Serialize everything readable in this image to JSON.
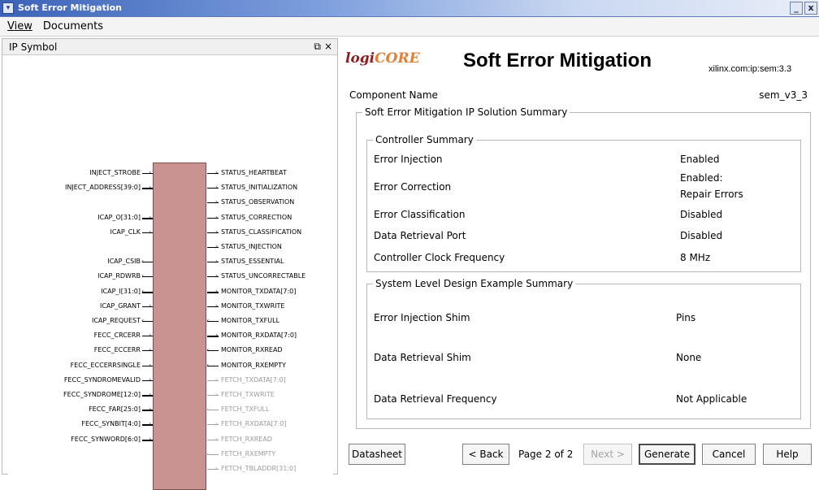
{
  "window": {
    "title": "Soft Error Mitigation",
    "sys_icon": "chevron-down-icon",
    "min_label": "_",
    "close_label": "x"
  },
  "menubar": {
    "items": [
      {
        "label": "View"
      },
      {
        "label": "Documents"
      }
    ]
  },
  "left_panel": {
    "title": "IP Symbol",
    "restore_glyph": "⧉",
    "close_glyph": "×",
    "inputs": [
      "INJECT_STROBE",
      "INJECT_ADDRESS[39:0]",
      "ICAP_O[31:0]",
      "ICAP_CLK",
      "ICAP_CSIB",
      "ICAP_RDWRB",
      "ICAP_I[31:0]",
      "ICAP_GRANT",
      "ICAP_REQUEST",
      "FECC_CRCERR",
      "FECC_ECCERR",
      "FECC_ECCERRSINGLE",
      "FECC_SYNDROMEVALID",
      "FECC_SYNDROME[12:0]",
      "FECC_FAR[25:0]",
      "FECC_SYNBIT[4:0]",
      "FECC_SYNWORD[6:0]"
    ],
    "outputs": [
      "STATUS_HEARTBEAT",
      "STATUS_INITIALIZATION",
      "STATUS_OBSERVATION",
      "STATUS_CORRECTION",
      "STATUS_CLASSIFICATION",
      "STATUS_INJECTION",
      "STATUS_ESSENTIAL",
      "STATUS_UNCORRECTABLE",
      "MONITOR_TXDATA[7:0]",
      "MONITOR_TXWRITE",
      "MONITOR_TXFULL",
      "MONITOR_RXDATA[7:0]",
      "MONITOR_RXREAD",
      "MONITOR_RXEMPTY",
      "FETCH_TXDATA[7:0]",
      "FETCH_TXWRITE",
      "FETCH_TXFULL",
      "FETCH_RXDATA[7:0]",
      "FETCH_RXREAD",
      "FETCH_RXEMPTY",
      "FETCH_TBLADDR[31:0]"
    ]
  },
  "header": {
    "logo_text_a": "logi",
    "logo_text_b": "CORE",
    "title": "Soft Error Mitigation",
    "vlnv": "xilinx.com:ip:sem:3.3"
  },
  "component": {
    "label": "Component Name",
    "value": "sem_v3_3"
  },
  "summary": {
    "legend": "Soft Error Mitigation IP Solution Summary",
    "controller": {
      "legend": "Controller Summary",
      "rows": [
        {
          "label": "Error Injection",
          "value": "Enabled"
        },
        {
          "label": "Error Correction",
          "value": "Enabled:",
          "value2": "Repair Errors"
        },
        {
          "label": "Error Classification",
          "value": "Disabled"
        },
        {
          "label": "Data Retrieval Port",
          "value": "Disabled"
        },
        {
          "label": "Controller Clock Frequency",
          "value": "8 MHz"
        }
      ]
    },
    "system": {
      "legend": "System Level Design Example Summary",
      "rows": [
        {
          "label": "Error Injection Shim",
          "value": "Pins"
        },
        {
          "label": "Data Retrieval Shim",
          "value": "None"
        },
        {
          "label": "Data Retrieval Frequency",
          "value": "Not Applicable"
        }
      ]
    }
  },
  "footer": {
    "datasheet": "Datasheet",
    "back": "< Back",
    "page": "Page 2 of 2",
    "next": "Next >",
    "generate": "Generate",
    "cancel": "Cancel",
    "help": "Help"
  }
}
